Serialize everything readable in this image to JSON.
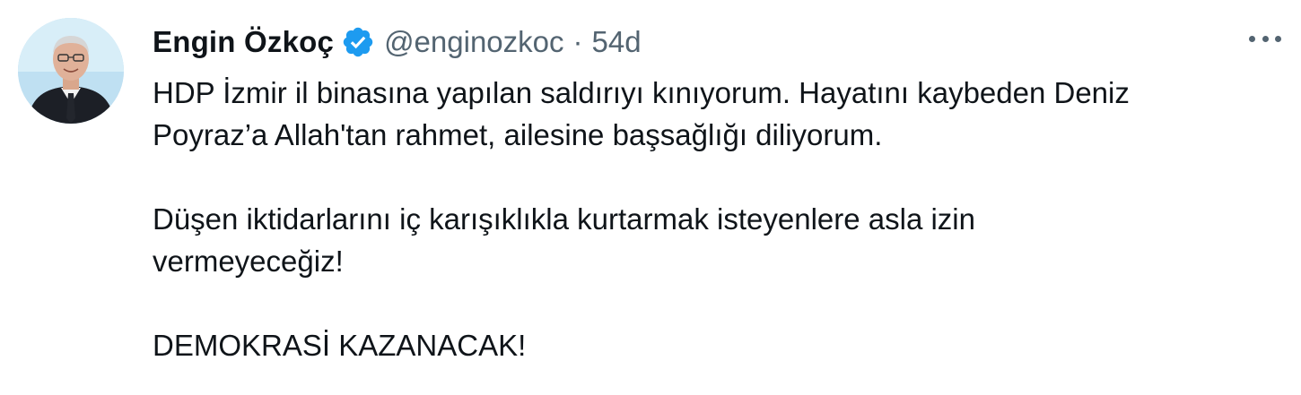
{
  "tweet": {
    "display_name": "Engin Özkoç",
    "handle": "@enginozkoc",
    "separator": "·",
    "time": "54d",
    "paragraphs": [
      [
        "HDP İzmir il binasına yapılan saldırıyı kınıyorum. Hayatını kaybeden Deniz",
        "Poyraz’a Allah'tan rahmet, ailesine başsağlığı diliyorum."
      ],
      [
        "Düşen iktidarlarını iç karışıklıkla kurtarmak isteyenlere asla izin",
        "vermeyeceğiz!"
      ],
      [
        "DEMOKRASİ KAZANACAK!"
      ]
    ]
  },
  "icons": {
    "verified": "verified-badge-icon",
    "more": "more-horizontal-icon"
  },
  "colors": {
    "primary_text": "#0f1419",
    "secondary_text": "#536471",
    "verified_blue": "#1d9bf0"
  }
}
